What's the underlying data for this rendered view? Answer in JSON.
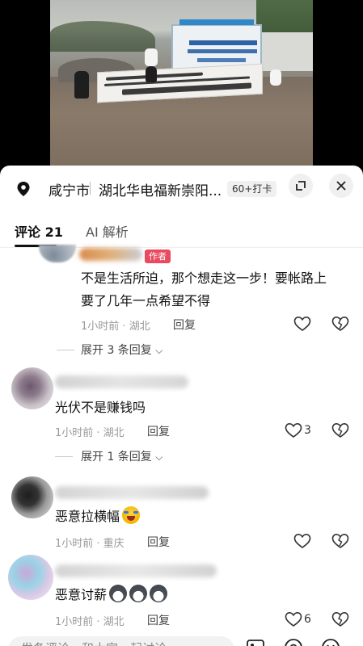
{
  "location": {
    "city": "咸宁市",
    "name": "湖北华电福新崇阳...",
    "checkins": "60+打卡"
  },
  "tabs": {
    "comments": "评论 21",
    "ai": "AI 解析"
  },
  "comments": [
    {
      "tag": "作者",
      "text_line1": "不是生活所迫，那个想走这一步！要帐路上",
      "text_line2": "要了几年一点希望不得",
      "meta": "1小时前 · 湖北",
      "reply": "回复",
      "likes": "",
      "expand": "展开 3 条回复"
    },
    {
      "text": "光伏不是赚钱吗",
      "meta": "1小时前 · 湖北",
      "reply": "回复",
      "likes": "3",
      "expand": "展开 1 条回复"
    },
    {
      "text": "恶意拉横幅",
      "emoji": "laughing-crying-emoji",
      "meta": "1小时前 · 重庆",
      "reply": "回复",
      "likes": ""
    },
    {
      "text": "恶意讨薪",
      "emoji": "husky-dog-emoji",
      "meta": "1小时前 · 湖北",
      "reply": "回复",
      "likes": "6"
    }
  ],
  "inputbar": {
    "placeholder": "发条评论，和大家一起讨论"
  },
  "colors": {
    "author_tag": "#e84a5f",
    "meta_text": "#999999"
  }
}
